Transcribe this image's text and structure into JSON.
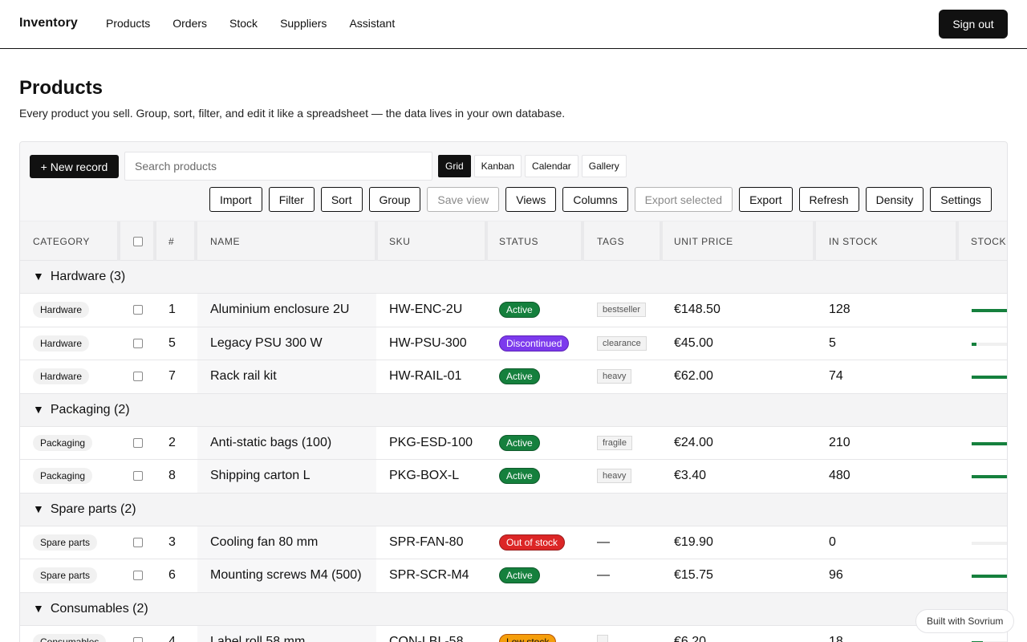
{
  "nav": {
    "brand": "Inventory",
    "links": [
      "Products",
      "Orders",
      "Stock",
      "Suppliers",
      "Assistant"
    ],
    "signout": "Sign out"
  },
  "page": {
    "title": "Products",
    "subtitle": "Every product you sell. Group, sort, filter, and edit it like a spreadsheet — the data lives in your own database."
  },
  "toolbar": {
    "new_record": "+ New record",
    "search_placeholder": "Search products",
    "views": [
      "Grid",
      "Kanban",
      "Calendar",
      "Gallery"
    ],
    "active_view": "Grid",
    "buttons": [
      "Import",
      "Filter",
      "Sort",
      "Group",
      "Save view",
      "Views",
      "Columns",
      "Export selected",
      "Export",
      "Refresh",
      "Density",
      "Settings"
    ],
    "disabled_buttons": [
      "Save view",
      "Export selected"
    ]
  },
  "columns": [
    "CATEGORY",
    "",
    "#",
    "NAME",
    "SKU",
    "STATUS",
    "TAGS",
    "UNIT PRICE",
    "IN STOCK",
    "STOCK"
  ],
  "groups": [
    {
      "label": "Hardware (3)",
      "rows": [
        {
          "category": "Hardware",
          "num": "1",
          "name": "Aluminium enclosure 2U",
          "sku": "HW-ENC-2U",
          "status": "Active",
          "tag": "bestseller",
          "price": "€148.50",
          "stock": "128",
          "stock_level": 1.0
        },
        {
          "category": "Hardware",
          "num": "5",
          "name": "Legacy PSU 300 W",
          "sku": "HW-PSU-300",
          "status": "Discontinued",
          "tag": "clearance",
          "price": "€45.00",
          "stock": "5",
          "stock_level": 0.13
        },
        {
          "category": "Hardware",
          "num": "7",
          "name": "Rack rail kit",
          "sku": "HW-RAIL-01",
          "status": "Active",
          "tag": "heavy",
          "price": "€62.00",
          "stock": "74",
          "stock_level": 1.0
        }
      ]
    },
    {
      "label": "Packaging (2)",
      "rows": [
        {
          "category": "Packaging",
          "num": "2",
          "name": "Anti-static bags (100)",
          "sku": "PKG-ESD-100",
          "status": "Active",
          "tag": "fragile",
          "price": "€24.00",
          "stock": "210",
          "stock_level": 1.0
        },
        {
          "category": "Packaging",
          "num": "8",
          "name": "Shipping carton L",
          "sku": "PKG-BOX-L",
          "status": "Active",
          "tag": "heavy",
          "price": "€3.40",
          "stock": "480",
          "stock_level": 1.0
        }
      ]
    },
    {
      "label": "Spare parts (2)",
      "rows": [
        {
          "category": "Spare parts",
          "num": "3",
          "name": "Cooling fan 80 mm",
          "sku": "SPR-FAN-80",
          "status": "Out of stock",
          "tag": "—",
          "price": "€19.90",
          "stock": "0",
          "stock_level": 0
        },
        {
          "category": "Spare parts",
          "num": "6",
          "name": "Mounting screws M4 (500)",
          "sku": "SPR-SCR-M4",
          "status": "Active",
          "tag": "—",
          "price": "€15.75",
          "stock": "96",
          "stock_level": 1.0
        }
      ]
    },
    {
      "label": "Consumables (2)",
      "rows": [
        {
          "category": "Consumables",
          "num": "4",
          "name": "Label roll 58 mm",
          "sku": "CON-LBL-58",
          "status": "Low stock",
          "tag": "",
          "price": "€6.20",
          "stock": "18",
          "stock_level": 0.3
        }
      ]
    }
  ],
  "built_with": "Built with Sovrium",
  "colors": {
    "active": "#15803d",
    "discontinued": "#7c3aed",
    "out_of_stock": "#dc2626",
    "low_stock": "#f59e0b"
  }
}
